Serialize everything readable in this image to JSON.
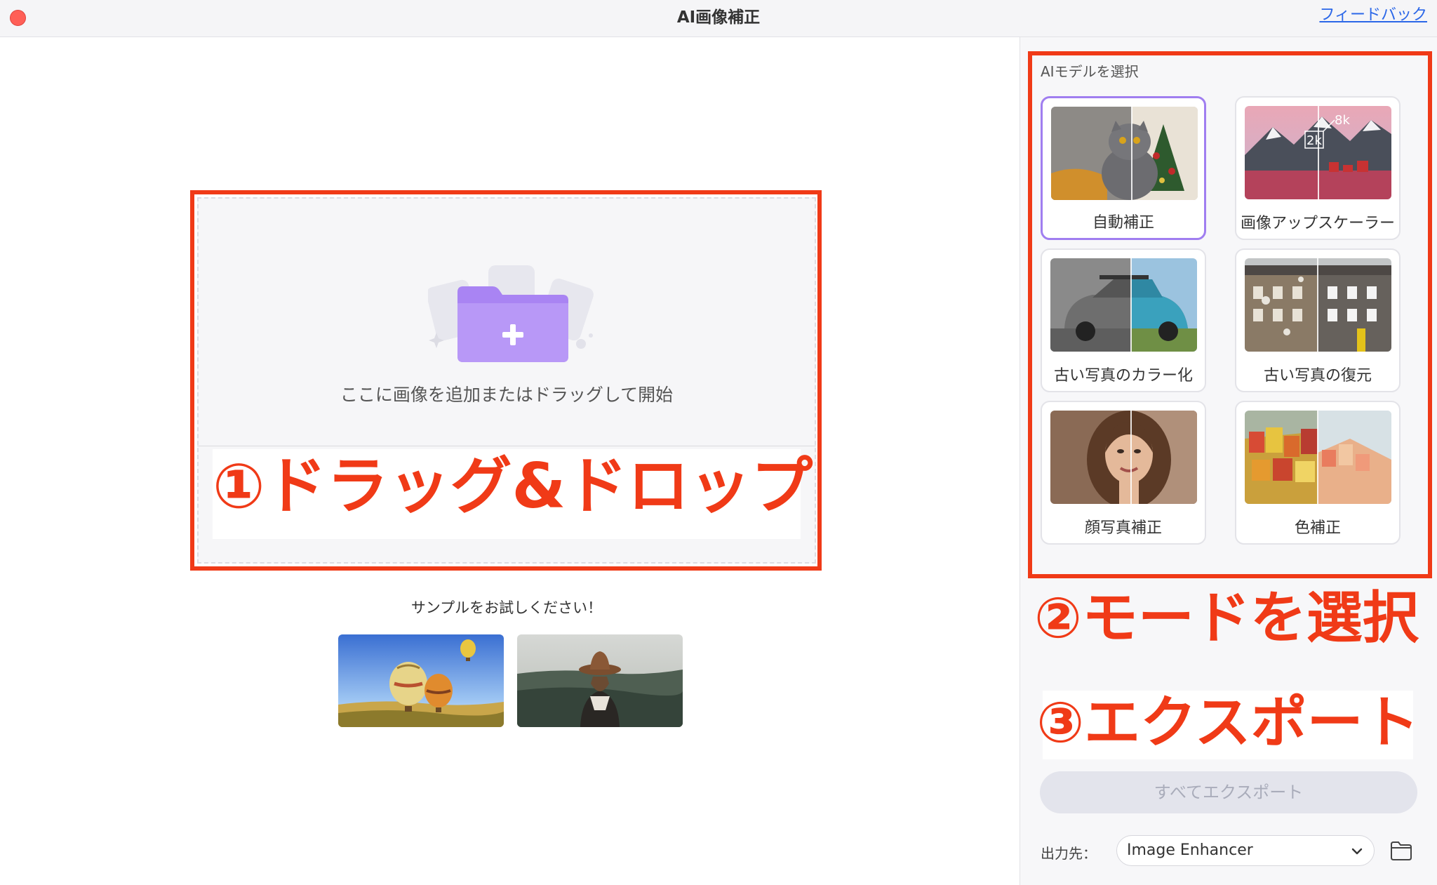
{
  "window": {
    "title": "AI画像補正",
    "feedback_link": "フィードバック"
  },
  "dropzone": {
    "prompt": "ここに画像を追加またはドラッグして開始"
  },
  "samples": {
    "label": "サンプルをお試しください！"
  },
  "ai_panel": {
    "section_label": "AIモデルを選択",
    "models": [
      {
        "label": "自動補正",
        "selected": true
      },
      {
        "label": "画像アップスケーラー",
        "selected": false,
        "badges": [
          "2k",
          "8k"
        ]
      },
      {
        "label": "古い写真のカラー化",
        "selected": false
      },
      {
        "label": "古い写真の復元",
        "selected": false
      },
      {
        "label": "顔写真補正",
        "selected": false
      },
      {
        "label": "色補正",
        "selected": false
      }
    ]
  },
  "annotations": {
    "step1": "①ドラッグ&ドロップ",
    "step2": "②モードを選択",
    "step3": "③エクスポート"
  },
  "export": {
    "button_label": "すべてエクスポート",
    "output_label": "出力先：",
    "output_value": "Image Enhancer"
  },
  "colors": {
    "accent": "#a07ef0",
    "annotation_red": "#f03a17",
    "folder_purple": "#a984f3"
  }
}
